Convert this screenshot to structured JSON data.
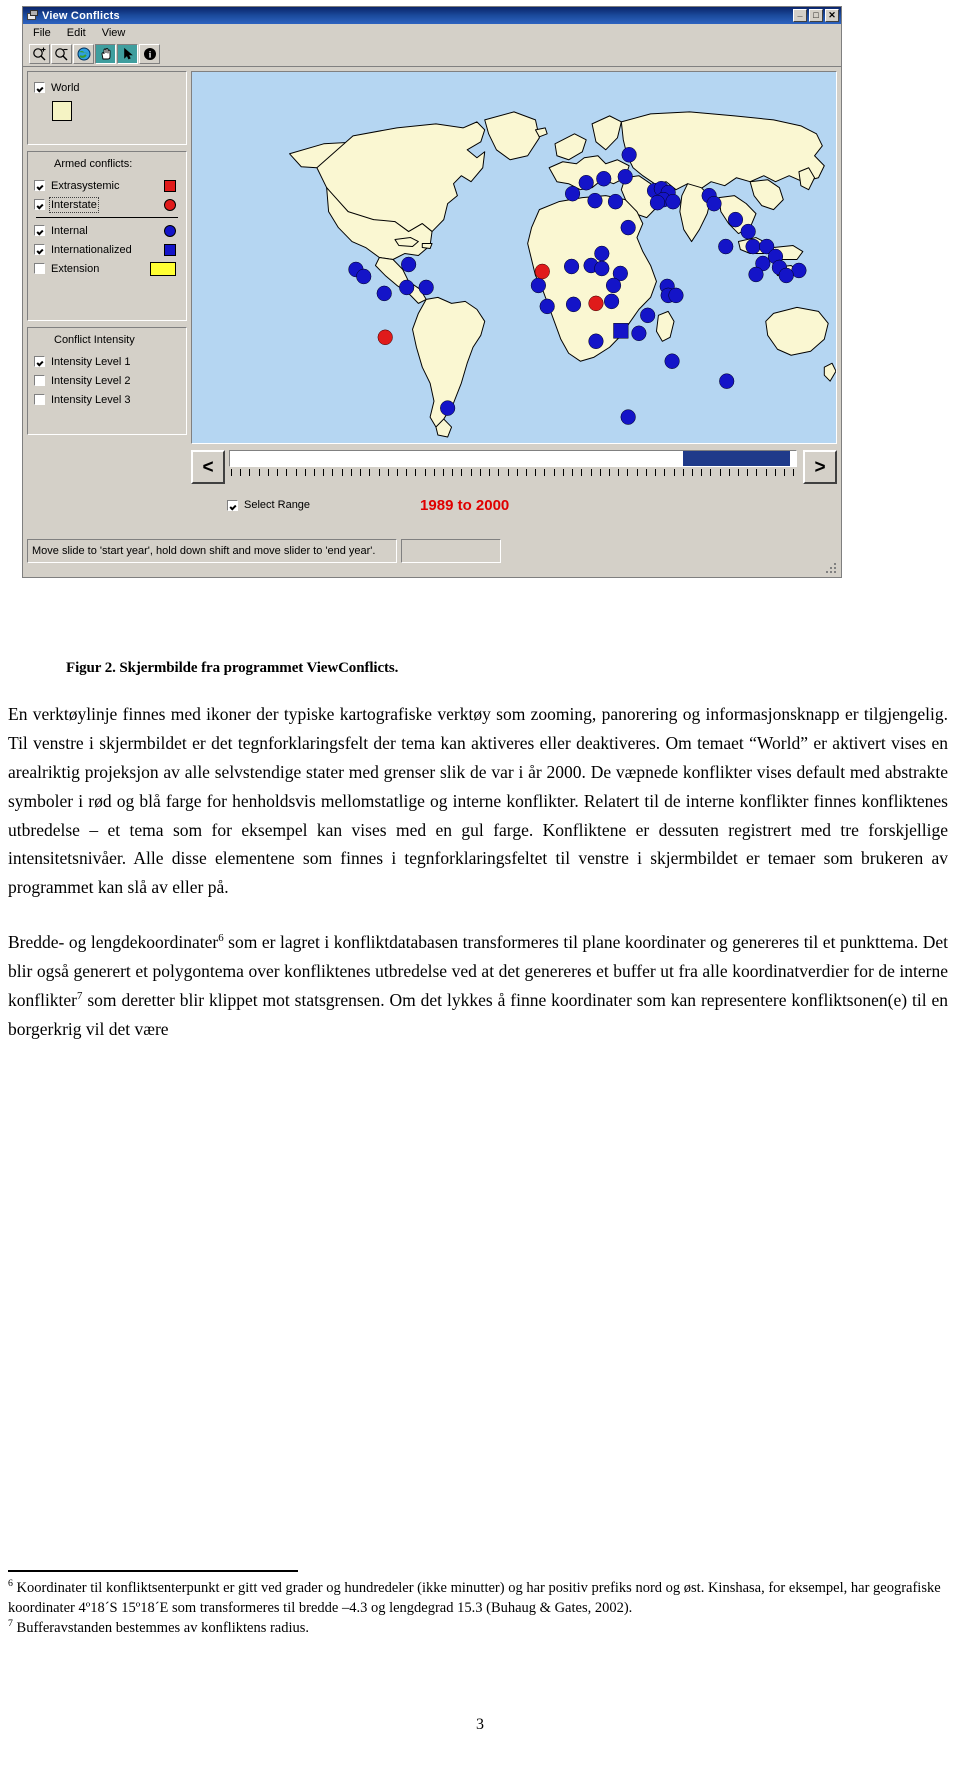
{
  "window": {
    "title": "View Conflicts",
    "title_icon": "app-window-icon",
    "buttons": {
      "minimize": "_",
      "maximize": "□",
      "close": "✕"
    },
    "menus": [
      "File",
      "Edit",
      "View"
    ],
    "toolbar": [
      {
        "name": "zoom-in-icon",
        "label": "Zoom In",
        "pressed": false
      },
      {
        "name": "zoom-out-icon",
        "label": "Zoom Out",
        "pressed": false
      },
      {
        "name": "globe-full-extent-icon",
        "label": "Full Extent",
        "pressed": false
      },
      {
        "name": "pan-hand-icon",
        "label": "Pan",
        "pressed": true
      },
      {
        "name": "select-arrow-icon",
        "label": "Select",
        "pressed": true
      },
      {
        "name": "info-icon",
        "label": "Info",
        "pressed": false
      }
    ]
  },
  "legend": {
    "world": {
      "label": "World",
      "checked": true,
      "swatch_color": "#f5f3c4"
    },
    "conflicts": {
      "title": "Armed conflicts:",
      "items": [
        {
          "label": "Extrasystemic",
          "checked": true,
          "shape": "square",
          "color": "#e01b1b",
          "focused": false
        },
        {
          "label": "Interstate",
          "checked": true,
          "shape": "circle",
          "color": "#e01b1b",
          "focused": true
        },
        {
          "label": "Internal",
          "checked": true,
          "shape": "circle",
          "color": "#1414c8",
          "focused": false
        },
        {
          "label": "Internationalized",
          "checked": true,
          "shape": "square",
          "color": "#1414c8",
          "focused": false
        },
        {
          "label": "Extension",
          "checked": false,
          "shape": "wide",
          "color": "#ffff33",
          "focused": false
        }
      ]
    },
    "intensity": {
      "title": "Conflict Intensity",
      "items": [
        {
          "label": "Intensity Level 1",
          "checked": true
        },
        {
          "label": "Intensity Level 2",
          "checked": false
        },
        {
          "label": "Intensity Level 3",
          "checked": false
        }
      ]
    }
  },
  "slider": {
    "prev_label": "<",
    "next_label": ">",
    "fill_start_pct": 80,
    "fill_end_pct": 99,
    "tick_count": 62,
    "select_range_label": "Select Range",
    "select_range_checked": true,
    "year_range": "1989 to 2000",
    "year_range_color": "#e00000"
  },
  "status": {
    "message": "Move slide to 'start year', hold down shift and move slider to 'end year'.",
    "aux": ""
  },
  "map": {
    "ocean_color": "#b5d6f2",
    "land_color": "#faf7d2",
    "border_color": "#000000",
    "markers": {
      "internal_color": "#1414c8",
      "interstate_color": "#e01b1b",
      "internationalized_color": "#1414c8"
    }
  },
  "document": {
    "caption": "Figur 2. Skjermbilde fra programmet ViewConflicts.",
    "paragraph_1_a": "En verktøylinje finnes med ikoner der typiske kartografiske verktøy som zooming, panorering og informasjonsknapp er tilgjengelig. Til venstre i skjermbildet er det tegnforklaringsfelt der tema kan aktiveres eller deaktiveres. Om temaet “World” er aktivert vises en arealriktig projeksjon av alle selvstendige stater med grenser slik de var i år 2000. De væpnede konflikter vises default med abstrakte symboler i rød og blå farge for henholdsvis mellomstatlige og interne konflikter. Relatert til de interne konflikter finnes konfliktenes utbredelse – et tema som for eksempel kan vises med en gul farge. Konfliktene er dessuten registrert med tre forskjellige intensitetsnivåer. Alle disse elementene som finnes i tegnforklaringsfeltet til venstre i skjermbildet er temaer som brukeren av programmet kan slå av eller på.",
    "paragraph_2_pre": "Bredde- og lengdekoordinater",
    "paragraph_2_sup1": "6",
    "paragraph_2_mid": " som er lagret i konfliktdatabasen transformeres til plane koordinater og genereres til et punkttema. Det blir også generert et polygontema over konfliktenes utbredelse ved at det genereres et buffer ut fra alle koordinatverdier for de interne konflikter",
    "paragraph_2_sup2": "7",
    "paragraph_2_post": " som deretter blir klippet mot statsgrensen. Om det lykkes å finne koordinater som kan representere konfliktsonen(e) til en borgerkrig vil det være",
    "footnote_6_marker": "6",
    "footnote_6": " Koordinater til konfliktsenterpunkt er gitt ved grader og hundredeler (ikke minutter) og har positiv prefiks nord og øst. Kinshasa, for eksempel, har geografiske koordinater 4º18´S 15º18´E som transformeres til bredde –4.3 og lengdegrad 15.3 (Buhaug & Gates, 2002).",
    "footnote_7_marker": "7",
    "footnote_7": " Bufferavstanden bestemmes av konfliktens radius.",
    "page_number": "3"
  }
}
